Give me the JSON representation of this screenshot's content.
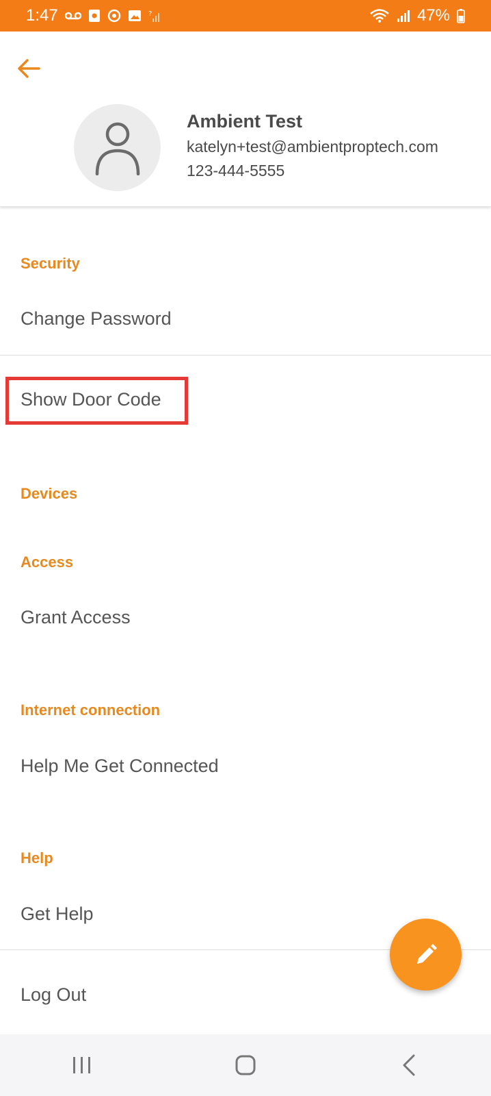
{
  "status_bar": {
    "time": "1:47",
    "battery": "47%",
    "icons_left": [
      "voicemail-icon",
      "photo-icon",
      "sync-icon",
      "gallery-icon",
      "no-signal-icon"
    ],
    "icons_right": [
      "wifi-icon",
      "signal-icon",
      "battery-icon"
    ]
  },
  "profile": {
    "name": "Ambient Test",
    "email": "katelyn+test@ambientproptech.com",
    "phone": "123-444-5555"
  },
  "sections": {
    "security": "Security",
    "devices": "Devices",
    "access": "Access",
    "internet": "Internet connection",
    "help": "Help"
  },
  "items": {
    "change_password": "Change Password",
    "show_door_code": "Show Door Code",
    "grant_access": "Grant Access",
    "help_connected": "Help Me Get Connected",
    "get_help": "Get Help",
    "log_out": "Log Out"
  },
  "colors": {
    "accent": "#f47c17",
    "section_title": "#e8891f",
    "fab": "#f7931e",
    "highlight": "#e53935"
  }
}
